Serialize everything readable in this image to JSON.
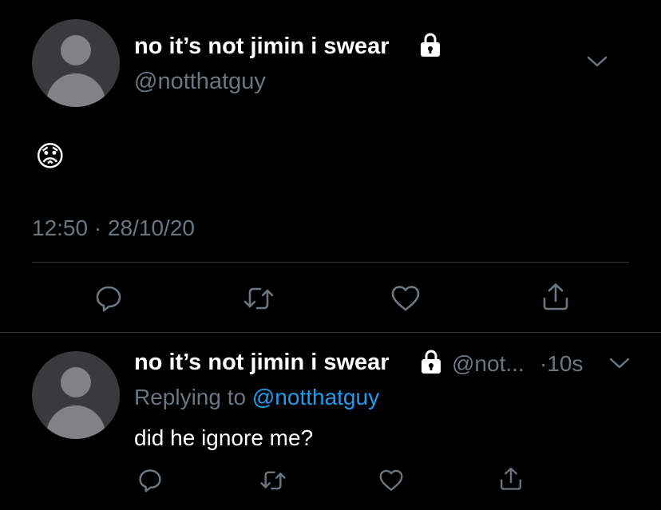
{
  "main_tweet": {
    "author_name": "no it’s not jimin i swear",
    "handle": "@notthatguy",
    "body_emoji": "😟",
    "time": "12:50",
    "separator": "·",
    "date": "28/10/20",
    "icons": {
      "lock": "lock-icon",
      "more": "chevron-down-icon",
      "reply": "reply-icon",
      "retweet": "retweet-icon",
      "like": "heart-icon",
      "share": "share-icon"
    }
  },
  "reply_tweet": {
    "author_name": "no it’s not jimin i swear",
    "handle_truncated": "@not...",
    "dot_time": "·10s",
    "replying_prefix": "Replying to ",
    "replying_handle": "@notthatguy",
    "body": "did he ignore me?"
  },
  "colors": {
    "background": "#000000",
    "muted_text": "#6e767d",
    "link": "#1d9bf0",
    "divider": "#2f3336",
    "avatar_bg": "#3a3a3c",
    "avatar_fg": "#828286"
  }
}
